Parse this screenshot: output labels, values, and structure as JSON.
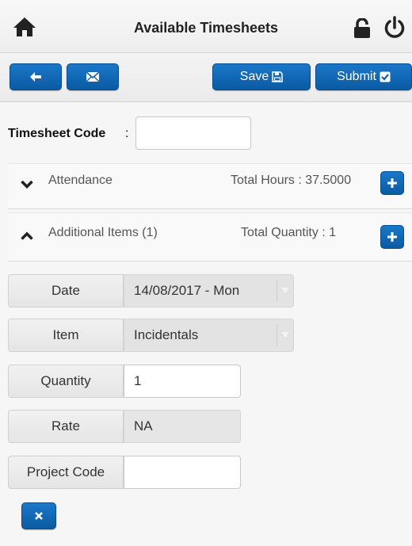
{
  "header": {
    "title": "Available Timesheets"
  },
  "toolbar": {
    "save_label": "Save",
    "submit_label": "Submit"
  },
  "timesheet_code": {
    "label": "Timesheet Code",
    "colon": ":",
    "value": ""
  },
  "sections": {
    "attendance": {
      "label": "Attendance",
      "summary": "Total Hours : 37.5000"
    },
    "additional": {
      "label": "Additional Items (1)",
      "summary": "Total Quantity : 1"
    }
  },
  "form": {
    "date": {
      "label": "Date",
      "value": "14/08/2017 - Mon"
    },
    "item": {
      "label": "Item",
      "value": "Incidentals"
    },
    "quantity": {
      "label": "Quantity",
      "value": "1"
    },
    "rate": {
      "label": "Rate",
      "value": "NA"
    },
    "project_code": {
      "label": "Project Code",
      "value": ""
    }
  },
  "icons": {
    "home": "home-icon",
    "lock": "lock-open-icon",
    "power": "power-icon",
    "back": "arrow-left-icon",
    "mail": "mail-icon",
    "save": "floppy-icon",
    "submit": "checkbox-icon",
    "chevron_down": "chevron-down-icon",
    "chevron_up": "chevron-up-icon",
    "plus": "plus-icon",
    "delete": "close-icon"
  },
  "colors": {
    "accent": "#0f64b0",
    "header_bg": "#f3f3f3"
  }
}
